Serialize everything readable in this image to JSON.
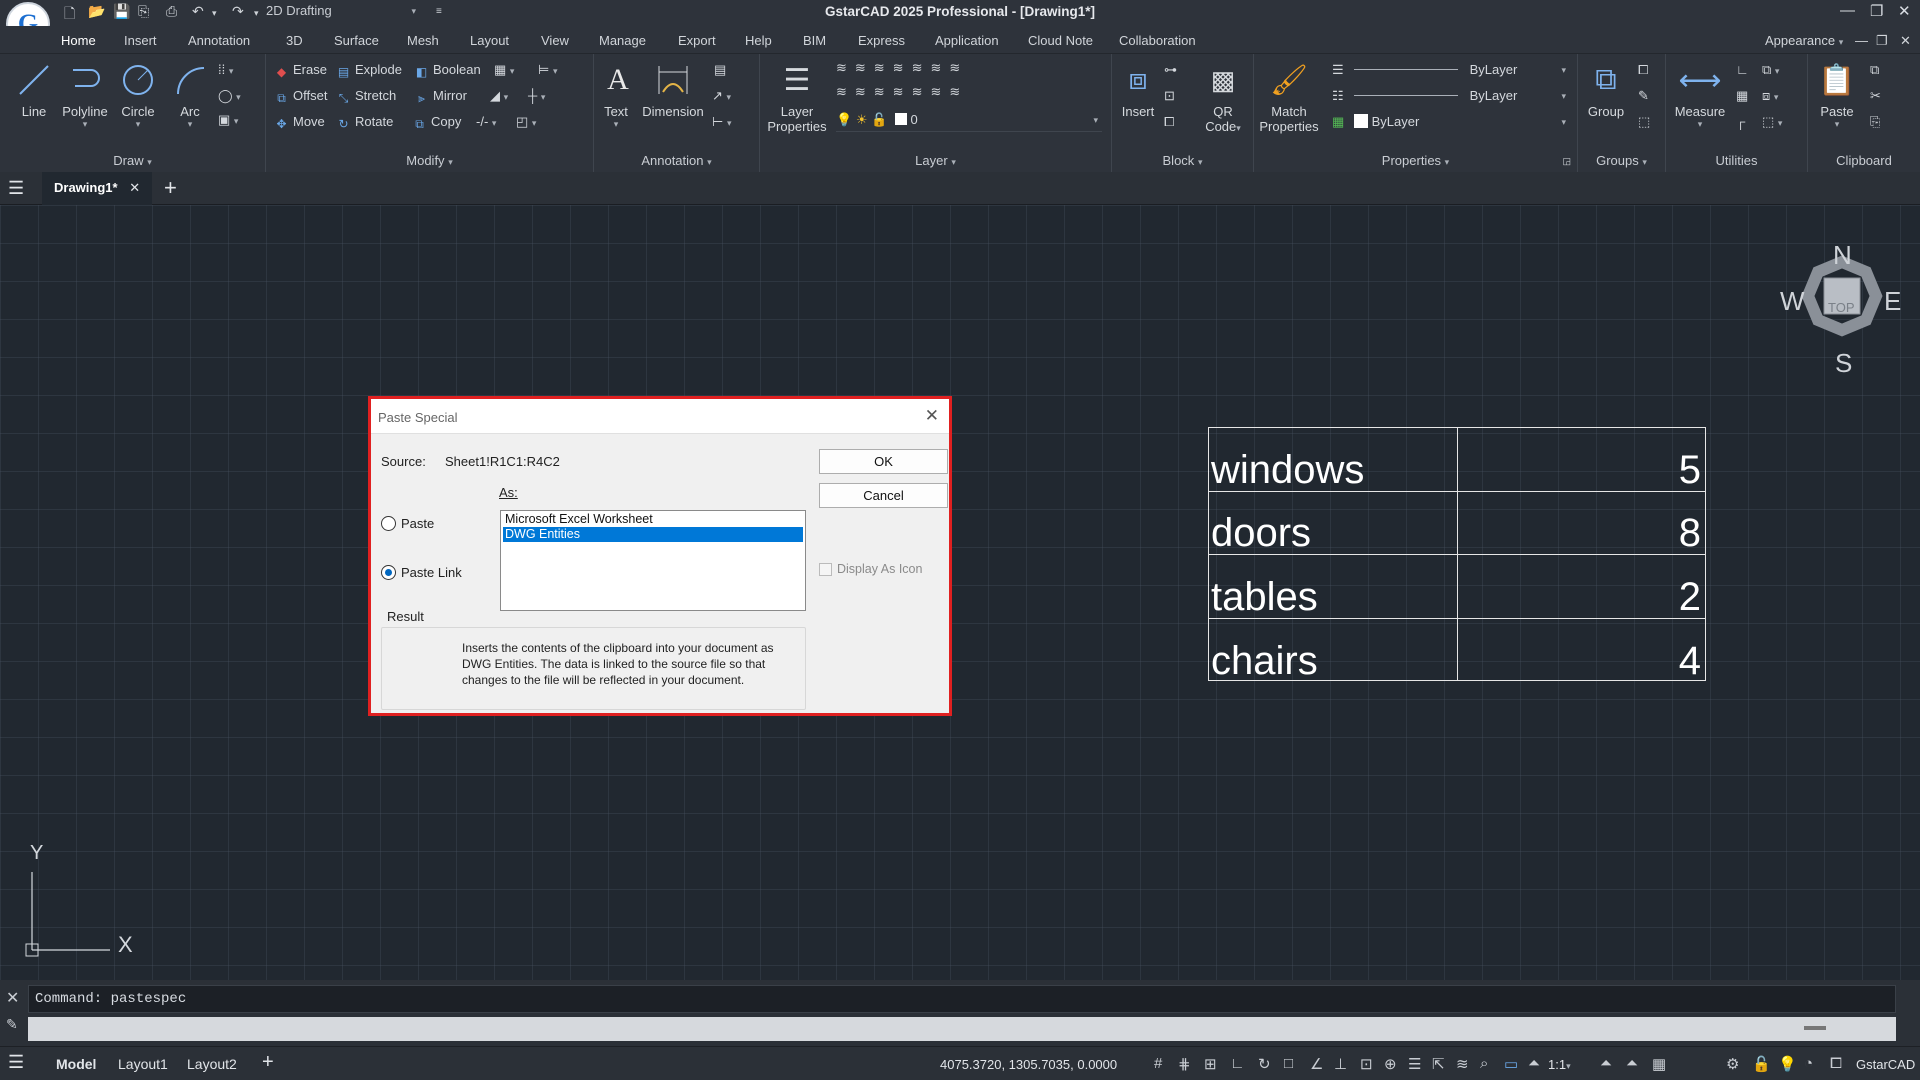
{
  "app": {
    "title": "GstarCAD 2025 Professional - [Drawing1*]",
    "workspace": "2D Drafting",
    "logo_letter": "G",
    "appearance": "Appearance"
  },
  "menu": {
    "tabs": [
      "Home",
      "Insert",
      "Annotation",
      "3D",
      "Surface",
      "Mesh",
      "Layout",
      "View",
      "Manage",
      "Export",
      "Help",
      "BIM",
      "Express",
      "Application",
      "Cloud Note",
      "Collaboration"
    ]
  },
  "ribbon": {
    "draw": {
      "label": "Draw",
      "line": "Line",
      "polyline": "Polyline",
      "circle": "Circle",
      "arc": "Arc"
    },
    "modify": {
      "label": "Modify",
      "erase": "Erase",
      "explode": "Explode",
      "boolean": "Boolean",
      "offset": "Offset",
      "stretch": "Stretch",
      "mirror": "Mirror",
      "move": "Move",
      "rotate": "Rotate",
      "copy": "Copy"
    },
    "annotation": {
      "label": "Annotation",
      "text": "Text",
      "dimension": "Dimension"
    },
    "layer": {
      "label": "Layer",
      "layer_properties_1": "Layer",
      "layer_properties_2": "Properties",
      "current_layer": "0"
    },
    "block": {
      "label": "Block",
      "insert": "Insert",
      "qr_1": "QR",
      "qr_2": "Code"
    },
    "properties": {
      "label": "Properties",
      "match_1": "Match",
      "match_2": "Properties",
      "linetype": "ByLayer",
      "lineweight": "ByLayer",
      "color": "ByLayer"
    },
    "groups": {
      "label": "Groups",
      "group": "Group"
    },
    "utilities": {
      "label": "Utilities",
      "measure": "Measure"
    },
    "clipboard": {
      "label": "Clipboard",
      "paste": "Paste"
    }
  },
  "doc_tabs": {
    "active": "Drawing1*"
  },
  "drawing_table": {
    "rows": [
      {
        "item": "windows",
        "qty": "5"
      },
      {
        "item": "doors",
        "qty": "8"
      },
      {
        "item": "tables",
        "qty": "2"
      },
      {
        "item": "chairs",
        "qty": "4"
      }
    ]
  },
  "viewcube": {
    "n": "N",
    "s": "S",
    "e": "E",
    "w": "W",
    "top": "TOP"
  },
  "ucs": {
    "x": "X",
    "y": "Y"
  },
  "dialog": {
    "title": "Paste Special",
    "source_label": "Source:",
    "source_value": "Sheet1!R1C1:R4C2",
    "as_label": "As:",
    "paste_label": "Paste",
    "paste_link_label": "Paste Link",
    "options": [
      "Microsoft Excel Worksheet",
      "DWG Entities"
    ],
    "selected_option": "DWG Entities",
    "ok": "OK",
    "cancel": "Cancel",
    "display_as_icon": "Display As Icon",
    "result_label": "Result",
    "result_text": "Inserts the contents of the clipboard into your document as DWG Entities.  The data is linked to the source file so that changes to the file will be reflected in your document."
  },
  "command": {
    "text": "Command: pastespec"
  },
  "status": {
    "model": "Model",
    "layout1": "Layout1",
    "layout2": "Layout2",
    "coords": "4075.3720, 1305.7035, 0.0000",
    "scale": "1:1",
    "brand": "GstarCAD"
  },
  "colors": {
    "accent": "#0b7ad1",
    "dialog_border": "#e02020",
    "selection": "#0078d7",
    "canvas": "#212830"
  }
}
